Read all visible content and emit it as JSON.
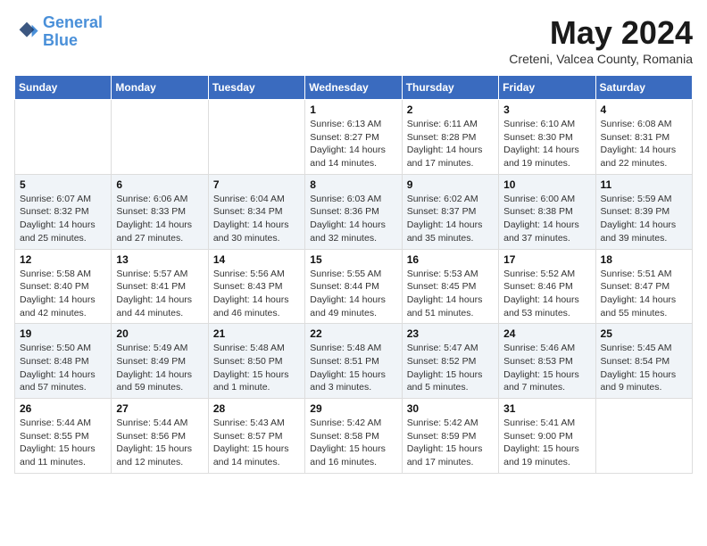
{
  "header": {
    "logo_line1": "General",
    "logo_line2": "Blue",
    "month_title": "May 2024",
    "subtitle": "Creteni, Valcea County, Romania"
  },
  "days_of_week": [
    "Sunday",
    "Monday",
    "Tuesday",
    "Wednesday",
    "Thursday",
    "Friday",
    "Saturday"
  ],
  "weeks": [
    [
      {
        "day": "",
        "detail": ""
      },
      {
        "day": "",
        "detail": ""
      },
      {
        "day": "",
        "detail": ""
      },
      {
        "day": "1",
        "detail": "Sunrise: 6:13 AM\nSunset: 8:27 PM\nDaylight: 14 hours and 14 minutes."
      },
      {
        "day": "2",
        "detail": "Sunrise: 6:11 AM\nSunset: 8:28 PM\nDaylight: 14 hours and 17 minutes."
      },
      {
        "day": "3",
        "detail": "Sunrise: 6:10 AM\nSunset: 8:30 PM\nDaylight: 14 hours and 19 minutes."
      },
      {
        "day": "4",
        "detail": "Sunrise: 6:08 AM\nSunset: 8:31 PM\nDaylight: 14 hours and 22 minutes."
      }
    ],
    [
      {
        "day": "5",
        "detail": "Sunrise: 6:07 AM\nSunset: 8:32 PM\nDaylight: 14 hours and 25 minutes."
      },
      {
        "day": "6",
        "detail": "Sunrise: 6:06 AM\nSunset: 8:33 PM\nDaylight: 14 hours and 27 minutes."
      },
      {
        "day": "7",
        "detail": "Sunrise: 6:04 AM\nSunset: 8:34 PM\nDaylight: 14 hours and 30 minutes."
      },
      {
        "day": "8",
        "detail": "Sunrise: 6:03 AM\nSunset: 8:36 PM\nDaylight: 14 hours and 32 minutes."
      },
      {
        "day": "9",
        "detail": "Sunrise: 6:02 AM\nSunset: 8:37 PM\nDaylight: 14 hours and 35 minutes."
      },
      {
        "day": "10",
        "detail": "Sunrise: 6:00 AM\nSunset: 8:38 PM\nDaylight: 14 hours and 37 minutes."
      },
      {
        "day": "11",
        "detail": "Sunrise: 5:59 AM\nSunset: 8:39 PM\nDaylight: 14 hours and 39 minutes."
      }
    ],
    [
      {
        "day": "12",
        "detail": "Sunrise: 5:58 AM\nSunset: 8:40 PM\nDaylight: 14 hours and 42 minutes."
      },
      {
        "day": "13",
        "detail": "Sunrise: 5:57 AM\nSunset: 8:41 PM\nDaylight: 14 hours and 44 minutes."
      },
      {
        "day": "14",
        "detail": "Sunrise: 5:56 AM\nSunset: 8:43 PM\nDaylight: 14 hours and 46 minutes."
      },
      {
        "day": "15",
        "detail": "Sunrise: 5:55 AM\nSunset: 8:44 PM\nDaylight: 14 hours and 49 minutes."
      },
      {
        "day": "16",
        "detail": "Sunrise: 5:53 AM\nSunset: 8:45 PM\nDaylight: 14 hours and 51 minutes."
      },
      {
        "day": "17",
        "detail": "Sunrise: 5:52 AM\nSunset: 8:46 PM\nDaylight: 14 hours and 53 minutes."
      },
      {
        "day": "18",
        "detail": "Sunrise: 5:51 AM\nSunset: 8:47 PM\nDaylight: 14 hours and 55 minutes."
      }
    ],
    [
      {
        "day": "19",
        "detail": "Sunrise: 5:50 AM\nSunset: 8:48 PM\nDaylight: 14 hours and 57 minutes."
      },
      {
        "day": "20",
        "detail": "Sunrise: 5:49 AM\nSunset: 8:49 PM\nDaylight: 14 hours and 59 minutes."
      },
      {
        "day": "21",
        "detail": "Sunrise: 5:48 AM\nSunset: 8:50 PM\nDaylight: 15 hours and 1 minute."
      },
      {
        "day": "22",
        "detail": "Sunrise: 5:48 AM\nSunset: 8:51 PM\nDaylight: 15 hours and 3 minutes."
      },
      {
        "day": "23",
        "detail": "Sunrise: 5:47 AM\nSunset: 8:52 PM\nDaylight: 15 hours and 5 minutes."
      },
      {
        "day": "24",
        "detail": "Sunrise: 5:46 AM\nSunset: 8:53 PM\nDaylight: 15 hours and 7 minutes."
      },
      {
        "day": "25",
        "detail": "Sunrise: 5:45 AM\nSunset: 8:54 PM\nDaylight: 15 hours and 9 minutes."
      }
    ],
    [
      {
        "day": "26",
        "detail": "Sunrise: 5:44 AM\nSunset: 8:55 PM\nDaylight: 15 hours and 11 minutes."
      },
      {
        "day": "27",
        "detail": "Sunrise: 5:44 AM\nSunset: 8:56 PM\nDaylight: 15 hours and 12 minutes."
      },
      {
        "day": "28",
        "detail": "Sunrise: 5:43 AM\nSunset: 8:57 PM\nDaylight: 15 hours and 14 minutes."
      },
      {
        "day": "29",
        "detail": "Sunrise: 5:42 AM\nSunset: 8:58 PM\nDaylight: 15 hours and 16 minutes."
      },
      {
        "day": "30",
        "detail": "Sunrise: 5:42 AM\nSunset: 8:59 PM\nDaylight: 15 hours and 17 minutes."
      },
      {
        "day": "31",
        "detail": "Sunrise: 5:41 AM\nSunset: 9:00 PM\nDaylight: 15 hours and 19 minutes."
      },
      {
        "day": "",
        "detail": ""
      }
    ]
  ]
}
